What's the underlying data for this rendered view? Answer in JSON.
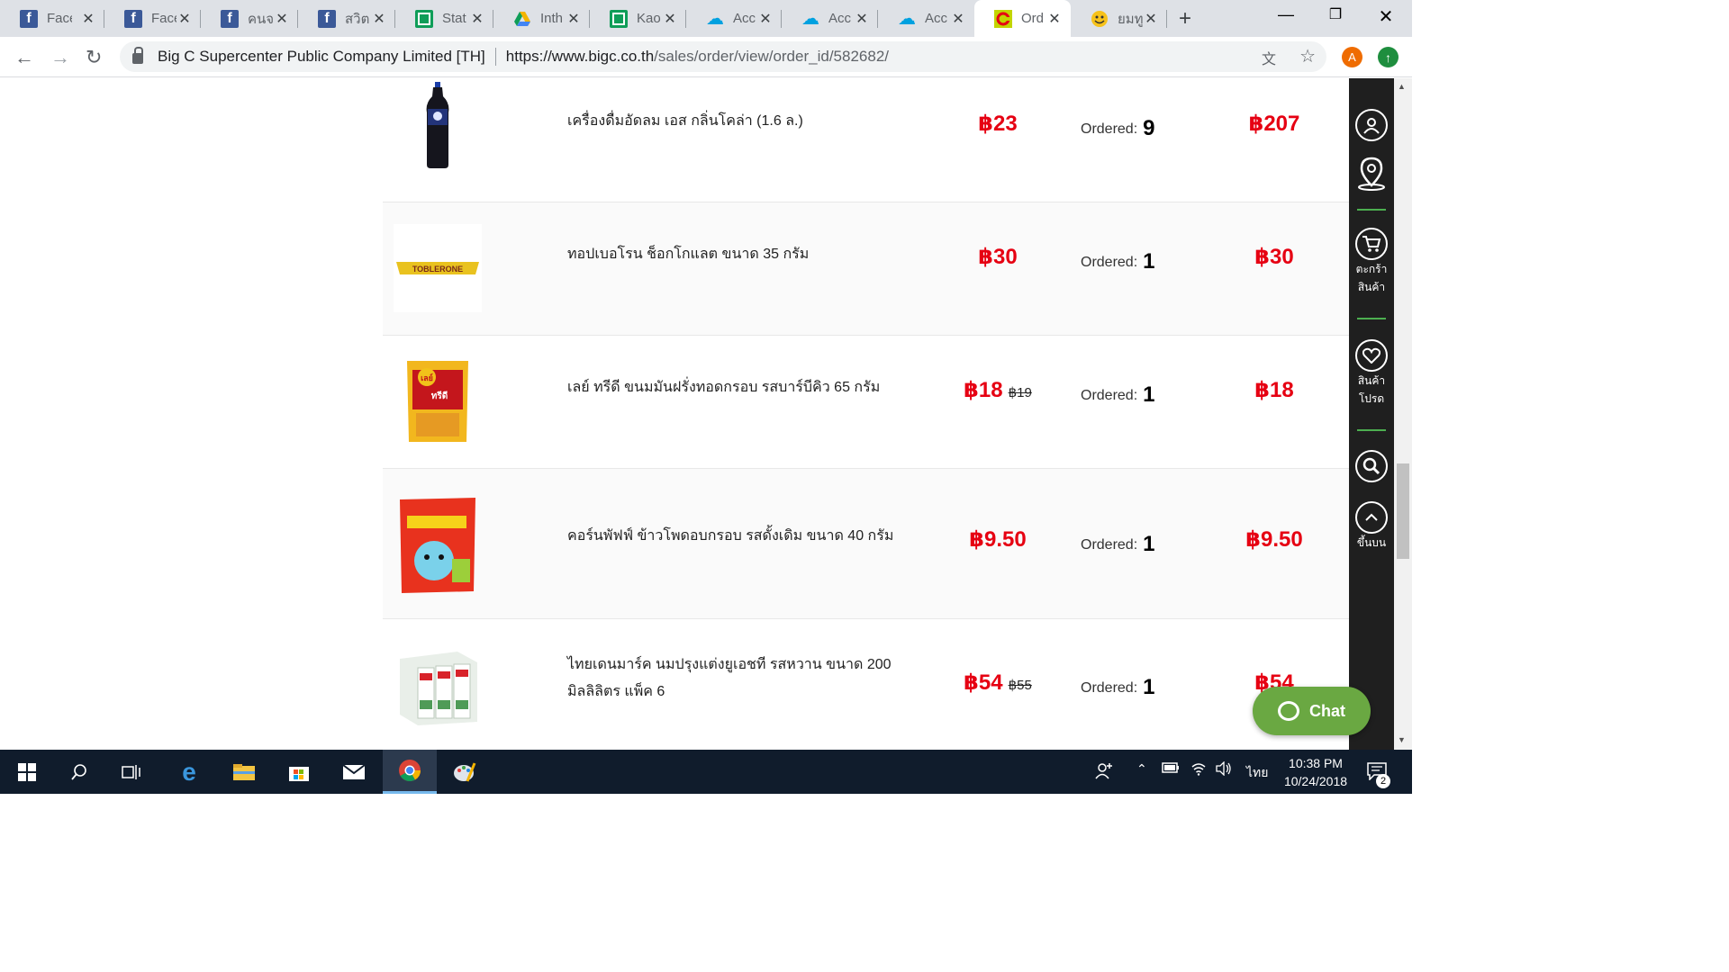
{
  "browser": {
    "tabs": [
      {
        "title": "Face",
        "icon": "facebook-icon"
      },
      {
        "title": "Face",
        "icon": "facebook-icon"
      },
      {
        "title": "คนจ",
        "icon": "facebook-icon"
      },
      {
        "title": "สวิต",
        "icon": "facebook-icon"
      },
      {
        "title": "Stat",
        "icon": "google-sheets-icon"
      },
      {
        "title": "Inth",
        "icon": "google-drive-icon"
      },
      {
        "title": "Kao",
        "icon": "google-sheets-icon"
      },
      {
        "title": "Acc",
        "icon": "salesforce-icon"
      },
      {
        "title": "Acc",
        "icon": "salesforce-icon"
      },
      {
        "title": "Acc",
        "icon": "salesforce-icon"
      },
      {
        "title": "Ord",
        "icon": "bigc-icon",
        "active": true
      },
      {
        "title": "ยมทู",
        "icon": "emoji-icon"
      }
    ],
    "address": {
      "org_name": "Big C Supercenter Public Company Limited [TH]",
      "url_host": "https://www.bigc.co.th",
      "url_path": "/sales/order/view/order_id/582682/"
    },
    "profile_initial": "A"
  },
  "order": {
    "ordered_label": "Ordered:",
    "items": [
      {
        "name": "เครื่องดื่มอัดลม เอส กลิ่นโคล่า (1.6 ล.)",
        "price": "฿23",
        "old_price": "",
        "qty": "9",
        "total": "฿207",
        "image": "soda-bottle"
      },
      {
        "name": "ทอปเบอโรน ช็อกโกแลต ขนาด 35 กรัม",
        "price": "฿30",
        "old_price": "",
        "qty": "1",
        "total": "฿30",
        "image": "toblerone"
      },
      {
        "name": "เลย์ ทรีดี ขนมมันฝรั่งทอดกรอบ รสบาร์บีคิว 65 กรัม",
        "price": "฿18",
        "old_price": "฿19",
        "qty": "1",
        "total": "฿18",
        "image": "lays-bag"
      },
      {
        "name": "คอร์นพัฟฟ์ ข้าวโพดอบกรอบ รสดั้งเดิม ขนาด 40 กรัม",
        "price": "฿9.50",
        "old_price": "",
        "qty": "1",
        "total": "฿9.50",
        "image": "cornpuff-bag"
      },
      {
        "name": "ไทยเดนมาร์ค นมปรุงแต่งยูเอชที รสหวาน ขนาด 200 มิลลิลิตร แพ็ค 6",
        "price": "฿54",
        "old_price": "฿55",
        "qty": "1",
        "total": "฿54",
        "image": "milk-pack"
      }
    ]
  },
  "sidebar": {
    "cart_label_1": "ตะกร้า",
    "cart_label_2": "สินค้า",
    "fav_label_1": "สินค้า",
    "fav_label_2": "โปรด",
    "top_label": "ขึ้นบน"
  },
  "chat": {
    "label": "Chat"
  },
  "taskbar": {
    "time": "10:38 PM",
    "date": "10/24/2018",
    "language": "ไทย",
    "notification_count": "2"
  },
  "toblerone_text": "TOBLERONE",
  "lays_logo": "เลย์",
  "lays_product": "ทรีดี"
}
